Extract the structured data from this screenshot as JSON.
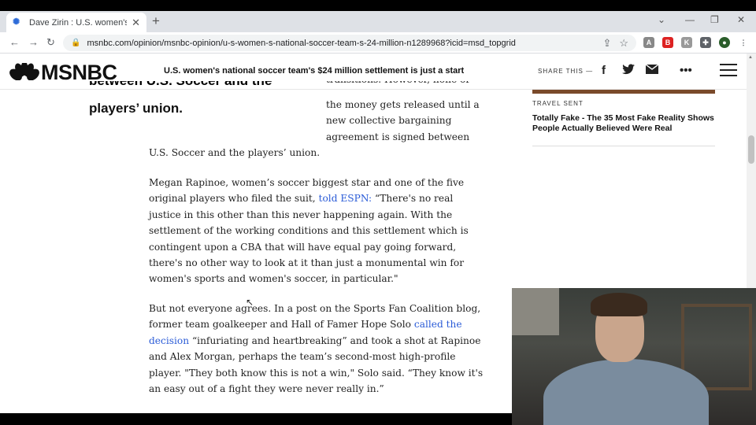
{
  "browser": {
    "tab_title": "Dave Zirin : U.S. women's nation",
    "tab_favicon": "msnbc-peacock-icon",
    "url": "msnbc.com/opinion/msnbc-opinion/u-s-women-s-national-soccer-team-s-24-million-n1289968?icid=msd_topgrid",
    "new_tab": "+",
    "close_tab": "✕"
  },
  "header": {
    "logo": "MSNBC",
    "article_title": "U.S. women's national soccer team's $24 million settlement is just a start",
    "share_label": "SHARE THIS —",
    "share_icons": [
      "facebook-icon",
      "twitter-icon",
      "email-icon",
      "more-icon"
    ],
    "more_label": "•••"
  },
  "article": {
    "pullquote_cut": "between U.S. Soccer and the",
    "pullquote_end": "players’ union.",
    "float_lines": [
      "transitions. However, none of",
      "the money gets released until a",
      "new collective bargaining",
      "agreement is signed between"
    ],
    "p1_end": "U.S. Soccer and the players’ union.",
    "p2_a": "Megan Rapinoe, women’s soccer biggest star and one of the five original players who filed the suit,",
    "p2_link": "told ESPN:",
    "p2_b": "“There's no real justice in this other than this never happening again. With the settlement of the working conditions and this settlement which is contingent upon a CBA that will have equal pay going forward, there's no other way to look at it than just a monumental win for women's sports and women's soccer, in particular.\"",
    "p3_a": "But not everyone agrees. In a post on the Sports Fan Coalition blog, former team goalkeeper and Hall of Famer Hope Solo",
    "p3_link": "called the decision",
    "p3_b": "“infuriating and heartbreaking” and took a shot at Rapinoe and Alex Morgan, perhaps the team’s second-most high-profile player. \"They both know this is not a win,\" Solo said. “They know it's an easy out of a fight they were never really in.”"
  },
  "sidebar": {
    "tag": "TRAVEL SENT",
    "title": "Totally Fake - The 35 Most Fake Reality Shows People Actually Believed Were Real"
  },
  "colors": {
    "link": "#2a5bd7",
    "text": "#222222"
  }
}
